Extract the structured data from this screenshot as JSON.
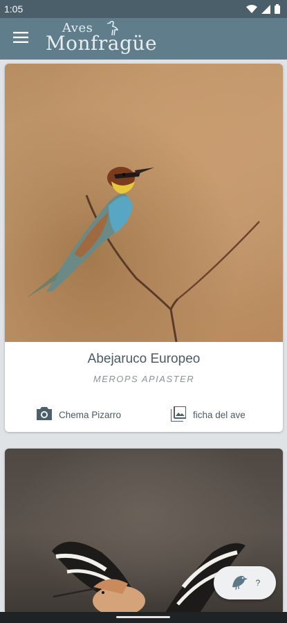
{
  "status_bar": {
    "time": "1:05",
    "icons": [
      "wifi-icon",
      "signal-icon",
      "battery-icon"
    ]
  },
  "app_bar": {
    "logo_small": "Aves",
    "logo_main": "Monfragüe",
    "menu_icon": "hamburger-menu-icon"
  },
  "feed": {
    "cards": [
      {
        "common_name": "Abejaruco Europeo",
        "scientific_name": "Merops apiaster",
        "photographer": "Chema Pizarro",
        "details_label": "ficha del ave"
      }
    ]
  },
  "fab": {
    "icon": "bird-icon",
    "label": "?"
  },
  "colors": {
    "app_bar": "#607d8b",
    "status_bar": "#4a5f69",
    "text_primary": "#4a5a63",
    "background": "#dfe3e6"
  }
}
